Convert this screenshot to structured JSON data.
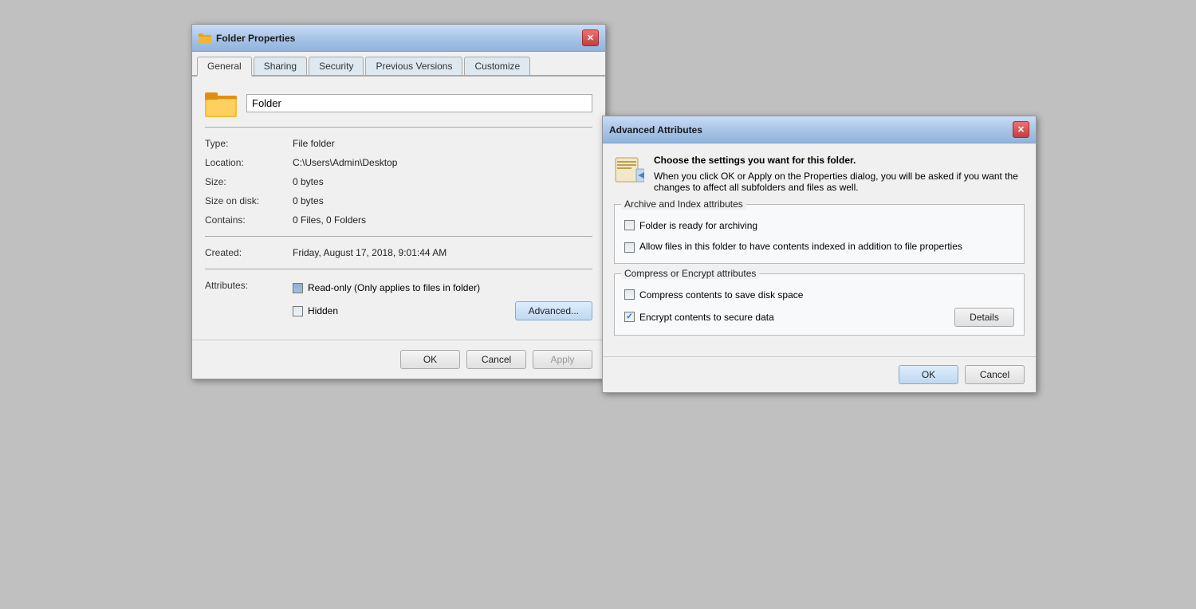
{
  "folderProps": {
    "title": "Folder Properties",
    "tabs": [
      {
        "label": "General",
        "active": true
      },
      {
        "label": "Sharing",
        "active": false
      },
      {
        "label": "Security",
        "active": false
      },
      {
        "label": "Previous Versions",
        "active": false
      },
      {
        "label": "Customize",
        "active": false
      }
    ],
    "folderName": "Folder",
    "properties": [
      {
        "label": "Type:",
        "value": "File folder"
      },
      {
        "label": "Location:",
        "value": "C:\\Users\\Admin\\Desktop"
      },
      {
        "label": "Size:",
        "value": "0 bytes"
      },
      {
        "label": "Size on disk:",
        "value": "0 bytes"
      },
      {
        "label": "Contains:",
        "value": "0 Files, 0 Folders"
      },
      {
        "label": "Created:",
        "value": "Friday, August 17, 2018, 9:01:44 AM"
      }
    ],
    "attributes": {
      "label": "Attributes:",
      "readOnly": {
        "checked": true,
        "label": "Read-only (Only applies to files in folder)"
      },
      "hidden": {
        "checked": false,
        "label": "Hidden"
      },
      "advancedBtn": "Advanced..."
    },
    "footer": {
      "ok": "OK",
      "cancel": "Cancel",
      "apply": "Apply"
    }
  },
  "advancedAttrs": {
    "title": "Advanced Attributes",
    "description1": "Choose the settings you want for this folder.",
    "description2": "When you click OK or Apply on the Properties dialog, you will be asked if you want the changes to affect all subfolders and files as well.",
    "archiveSection": {
      "title": "Archive and Index attributes",
      "items": [
        {
          "checked": false,
          "label": "Folder is ready for archiving"
        },
        {
          "checked": false,
          "label": "Allow files in this folder to have contents indexed in addition to file properties"
        }
      ]
    },
    "compressSection": {
      "title": "Compress or Encrypt attributes",
      "items": [
        {
          "checked": false,
          "label": "Compress contents to save disk space"
        },
        {
          "checked": true,
          "label": "Encrypt contents to secure data"
        }
      ],
      "detailsBtn": "Details"
    },
    "footer": {
      "ok": "OK",
      "cancel": "Cancel"
    }
  }
}
